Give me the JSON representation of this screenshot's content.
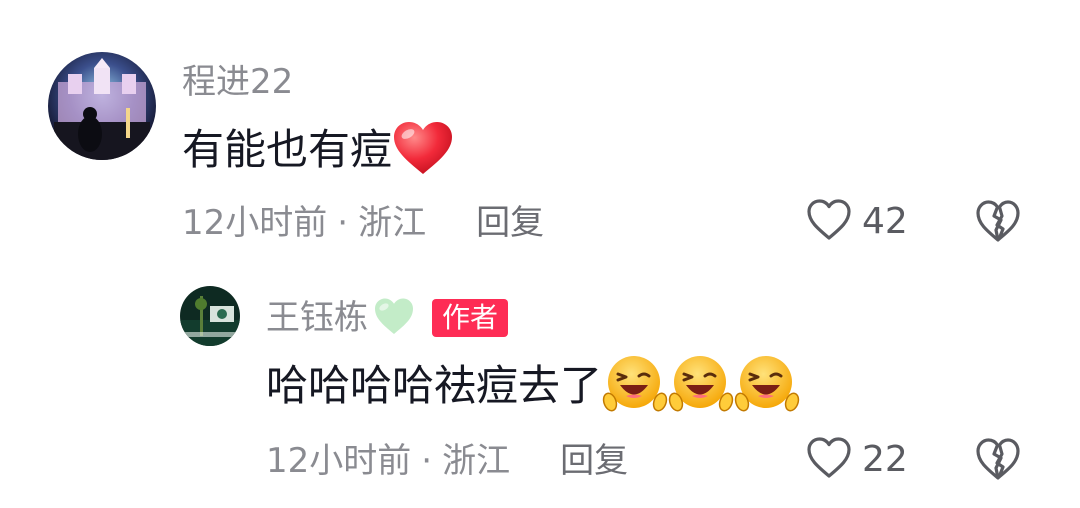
{
  "comments": [
    {
      "username": "程进22",
      "text": "有能也有痘",
      "emojis": [
        "red-heart-emoji"
      ],
      "time": "12小时前",
      "separator": "·",
      "location": "浙江",
      "reply_label": "回复",
      "like_count": "42",
      "is_author": false
    },
    {
      "username": "王钰栋",
      "username_emoji": "green-heart-emoji",
      "author_badge": "作者",
      "text": "哈哈哈哈祛痘去了",
      "emojis": [
        "laughing-emoji",
        "laughing-emoji",
        "laughing-emoji"
      ],
      "time": "12小时前",
      "separator": "·",
      "location": "浙江",
      "reply_label": "回复",
      "like_count": "22",
      "is_author": true
    }
  ],
  "colors": {
    "username": "#8a8b91",
    "text": "#161823",
    "meta": "#8a8b91",
    "author_badge_bg": "#fe2c55",
    "author_badge_text": "#ffffff"
  }
}
